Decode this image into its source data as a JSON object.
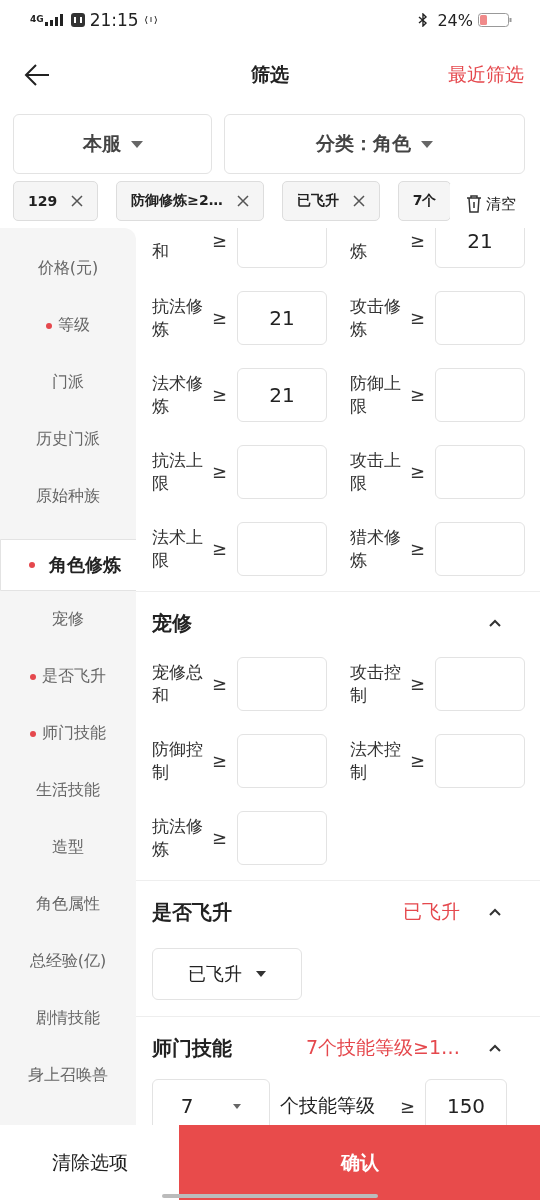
{
  "status_bar": {
    "network": "4G",
    "time": "21:15",
    "battery": "24%"
  },
  "header": {
    "title": "筛选",
    "action": "最近筛选"
  },
  "dropdowns": [
    {
      "label": "本服"
    },
    {
      "label": "分类：角色"
    }
  ],
  "chips": [
    {
      "label": "129",
      "removable": true
    },
    {
      "label": "防御修炼≥2…",
      "removable": true
    },
    {
      "label": "已飞升",
      "removable": true
    },
    {
      "label": "7个",
      "removable": false
    }
  ],
  "clear_chips": "清空",
  "sidebar": {
    "items": [
      {
        "label": "价格(元)",
        "selected": false,
        "marked": false
      },
      {
        "label": "等级",
        "selected": false,
        "marked": true
      },
      {
        "label": "门派",
        "selected": false,
        "marked": false
      },
      {
        "label": "历史门派",
        "selected": false,
        "marked": false
      },
      {
        "label": "原始种族",
        "selected": false,
        "marked": false
      },
      {
        "label": "角色修炼",
        "selected": true,
        "marked": true
      },
      {
        "label": "宠修",
        "selected": false,
        "marked": false
      },
      {
        "label": "是否飞升",
        "selected": false,
        "marked": true
      },
      {
        "label": "师门技能",
        "selected": false,
        "marked": true
      },
      {
        "label": "生活技能",
        "selected": false,
        "marked": false
      },
      {
        "label": "造型",
        "selected": false,
        "marked": false
      },
      {
        "label": "角色属性",
        "selected": false,
        "marked": false
      },
      {
        "label": "总经验(亿)",
        "selected": false,
        "marked": false
      },
      {
        "label": "剧情技能",
        "selected": false,
        "marked": false
      },
      {
        "label": "身上召唤兽",
        "selected": false,
        "marked": false
      }
    ]
  },
  "sections": [
    {
      "kind": "fields",
      "fields": [
        {
          "label": "和",
          "op": "≥"
        },
        {
          "label": "炼",
          "op": "≥",
          "value": "21"
        },
        {
          "label": "抗法修炼",
          "op": "≥",
          "value": "21"
        },
        {
          "label": "攻击修炼",
          "op": "≥"
        },
        {
          "label": "法术修炼",
          "op": "≥",
          "value": "21"
        },
        {
          "label": "防御上限",
          "op": "≥"
        },
        {
          "label": "抗法上限",
          "op": "≥"
        },
        {
          "label": "攻击上限",
          "op": "≥"
        },
        {
          "label": "法术上限",
          "op": "≥"
        },
        {
          "label": "猎术修炼",
          "op": "≥"
        }
      ]
    },
    {
      "kind": "fields",
      "title": "宠修",
      "expanded": true,
      "fields": [
        {
          "label": "宠修总和",
          "op": "≥"
        },
        {
          "label": "攻击控制",
          "op": "≥"
        },
        {
          "label": "防御控制",
          "op": "≥"
        },
        {
          "label": "法术控制",
          "op": "≥"
        },
        {
          "label": "抗法修炼",
          "op": "≥"
        }
      ]
    },
    {
      "kind": "select",
      "title": "是否飞升",
      "summary": "已飞升",
      "expanded": true,
      "select": "已飞升"
    },
    {
      "kind": "skill",
      "title": "师门技能",
      "summary": "7个技能等级≥1…",
      "expanded": true,
      "count": "7",
      "text": "个技能等级",
      "op": "≥",
      "value": "150"
    }
  ],
  "footer": {
    "clear": "清除选项",
    "confirm": "确认"
  }
}
